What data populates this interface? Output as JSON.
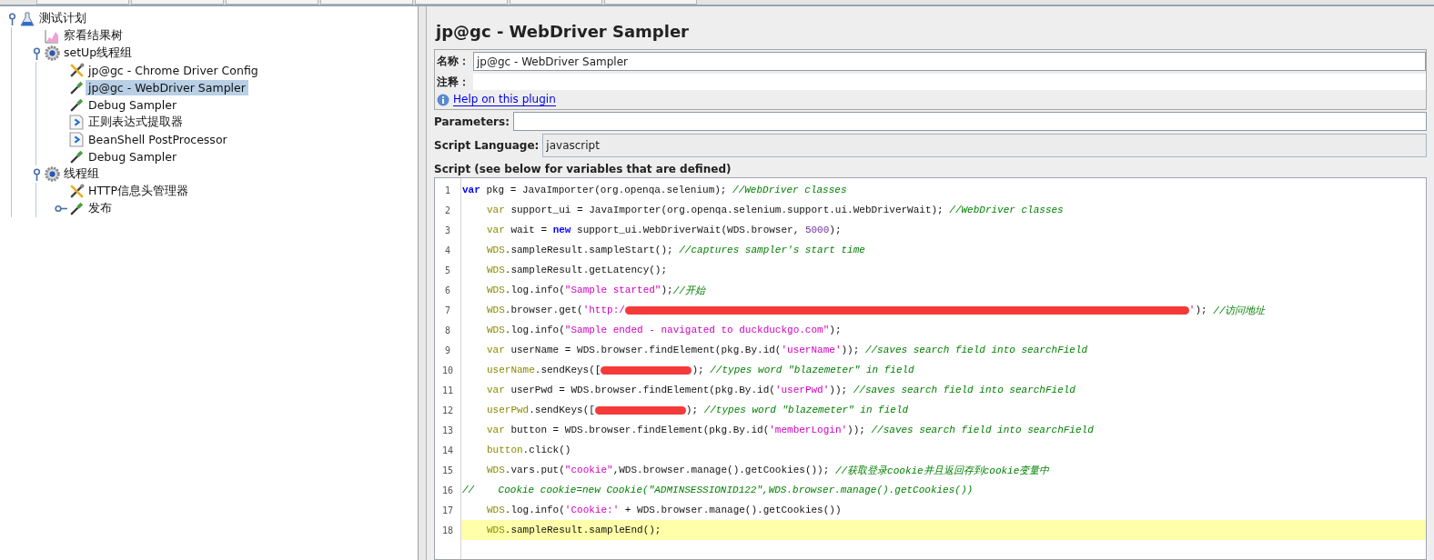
{
  "tree": [
    {
      "label": "测试计划",
      "kind": "plan",
      "selected": false,
      "expanded": true,
      "children": [
        {
          "label": "察看结果树",
          "kind": "listener",
          "selected": false
        },
        {
          "label": "setUp线程组",
          "kind": "threadgroup",
          "selected": false,
          "expanded": true,
          "children": [
            {
              "label": "jp@gc - Chrome Driver Config",
              "kind": "config",
              "selected": false
            },
            {
              "label": "jp@gc - WebDriver Sampler",
              "kind": "sampler",
              "selected": true
            },
            {
              "label": "Debug Sampler",
              "kind": "sampler",
              "selected": false
            },
            {
              "label": "正则表达式提取器",
              "kind": "postprocessor",
              "selected": false
            },
            {
              "label": "BeanShell PostProcessor",
              "kind": "postprocessor",
              "selected": false
            },
            {
              "label": "Debug Sampler",
              "kind": "sampler",
              "selected": false
            }
          ]
        },
        {
          "label": "线程组",
          "kind": "threadgroup",
          "selected": false,
          "expanded": true,
          "children": [
            {
              "label": "HTTP信息头管理器",
              "kind": "config",
              "selected": false
            },
            {
              "label": "发布",
              "kind": "sampler",
              "selected": false,
              "expanded": false
            }
          ]
        }
      ]
    }
  ],
  "panel": {
    "title": "jp@gc - WebDriver Sampler",
    "name_label": "名称：",
    "name_value": "jp@gc - WebDriver Sampler",
    "comment_label": "注释：",
    "help_link": "Help on this plugin",
    "parameters_label": "Parameters:",
    "language_label": "Script Language:",
    "language_value": "javascript",
    "script_label": "Script (see below for variables that are defined)"
  },
  "code": [
    {
      "number": "1",
      "indented": false,
      "highlighted": false,
      "parts": [
        {
          "kind": "keyword",
          "text": "var"
        },
        {
          "kind": "text",
          "text": " pkg = JavaImporter(org.openqa.selenium); "
        },
        {
          "kind": "comment",
          "text": "//WebDriver classes"
        }
      ]
    },
    {
      "number": "2",
      "indented": true,
      "highlighted": false,
      "parts": [
        {
          "kind": "decl",
          "text": "var"
        },
        {
          "kind": "text",
          "text": " support_ui = JavaImporter(org.openqa.selenium.support.ui.WebDriverWait); "
        },
        {
          "kind": "comment",
          "text": "//WebDriver classes"
        }
      ]
    },
    {
      "number": "3",
      "indented": true,
      "highlighted": false,
      "parts": [
        {
          "kind": "decl",
          "text": "var"
        },
        {
          "kind": "text",
          "text": " wait = "
        },
        {
          "kind": "keyword",
          "text": "new"
        },
        {
          "kind": "text",
          "text": " support_ui.WebDriverWait(WDS.browser, "
        },
        {
          "kind": "number",
          "text": "5000"
        },
        {
          "kind": "text",
          "text": ");"
        }
      ]
    },
    {
      "number": "4",
      "indented": true,
      "highlighted": false,
      "parts": [
        {
          "kind": "decl",
          "text": "WDS"
        },
        {
          "kind": "text",
          "text": ".sampleResult.sampleStart(); "
        },
        {
          "kind": "comment",
          "text": "//captures sampler's start time"
        }
      ]
    },
    {
      "number": "5",
      "indented": true,
      "highlighted": false,
      "parts": [
        {
          "kind": "decl",
          "text": "WDS"
        },
        {
          "kind": "text",
          "text": ".sampleResult.getLatency();"
        }
      ]
    },
    {
      "number": "6",
      "indented": true,
      "highlighted": false,
      "parts": [
        {
          "kind": "decl",
          "text": "WDS"
        },
        {
          "kind": "text",
          "text": ".log.info("
        },
        {
          "kind": "string",
          "text": "\"Sample started\""
        },
        {
          "kind": "text",
          "text": ");"
        },
        {
          "kind": "comment",
          "text": "//开始"
        }
      ]
    },
    {
      "number": "7",
      "indented": true,
      "highlighted": false,
      "parts": [
        {
          "kind": "decl",
          "text": "WDS"
        },
        {
          "kind": "text",
          "text": ".browser.get("
        },
        {
          "kind": "string",
          "text": "'http:/"
        },
        {
          "kind": "redacted"
        },
        {
          "kind": "string",
          "text": "'"
        },
        {
          "kind": "text",
          "text": "); "
        },
        {
          "kind": "comment",
          "text": "//访问地址"
        }
      ]
    },
    {
      "number": "8",
      "indented": true,
      "highlighted": false,
      "parts": [
        {
          "kind": "decl",
          "text": "WDS"
        },
        {
          "kind": "text",
          "text": ".log.info("
        },
        {
          "kind": "string",
          "text": "\"Sample ended - navigated to duckduckgo.com\""
        },
        {
          "kind": "text",
          "text": ");"
        }
      ]
    },
    {
      "number": "9",
      "indented": true,
      "highlighted": false,
      "parts": [
        {
          "kind": "decl",
          "text": "var"
        },
        {
          "kind": "text",
          "text": " userName = WDS.browser.findElement(pkg.By.id("
        },
        {
          "kind": "string",
          "text": "'userName'"
        },
        {
          "kind": "text",
          "text": ")); "
        },
        {
          "kind": "comment",
          "text": "//saves search field into searchField"
        }
      ]
    },
    {
      "number": "10",
      "indented": true,
      "highlighted": false,
      "parts": [
        {
          "kind": "decl",
          "text": "userName"
        },
        {
          "kind": "text",
          "text": ".sendKeys(["
        },
        {
          "kind": "redacted"
        },
        {
          "kind": "text",
          "text": "); "
        },
        {
          "kind": "comment",
          "text": "//types word \"blazemeter\" in field"
        }
      ]
    },
    {
      "number": "11",
      "indented": true,
      "highlighted": false,
      "parts": [
        {
          "kind": "decl",
          "text": "var"
        },
        {
          "kind": "text",
          "text": " userPwd = WDS.browser.findElement(pkg.By.id("
        },
        {
          "kind": "string",
          "text": "'userPwd'"
        },
        {
          "kind": "text",
          "text": ")); "
        },
        {
          "kind": "comment",
          "text": "//saves search field into searchField"
        }
      ]
    },
    {
      "number": "12",
      "indented": true,
      "highlighted": false,
      "parts": [
        {
          "kind": "decl",
          "text": "userPwd"
        },
        {
          "kind": "text",
          "text": ".sendKeys(["
        },
        {
          "kind": "redacted"
        },
        {
          "kind": "text",
          "text": "); "
        },
        {
          "kind": "comment",
          "text": "//types word \"blazemeter\" in field"
        }
      ]
    },
    {
      "number": "13",
      "indented": true,
      "highlighted": false,
      "parts": [
        {
          "kind": "decl",
          "text": "var"
        },
        {
          "kind": "text",
          "text": " button = WDS.browser.findElement(pkg.By.id("
        },
        {
          "kind": "string",
          "text": "'memberLogin'"
        },
        {
          "kind": "text",
          "text": ")); "
        },
        {
          "kind": "comment",
          "text": "//saves search field into searchField"
        }
      ]
    },
    {
      "number": "14",
      "indented": true,
      "highlighted": false,
      "parts": [
        {
          "kind": "decl",
          "text": "button"
        },
        {
          "kind": "text",
          "text": ".click()"
        }
      ]
    },
    {
      "number": "15",
      "indented": true,
      "highlighted": false,
      "parts": [
        {
          "kind": "decl",
          "text": "WDS"
        },
        {
          "kind": "text",
          "text": ".vars.put("
        },
        {
          "kind": "string",
          "text": "\"cookie\""
        },
        {
          "kind": "text",
          "text": ",WDS.browser.manage().getCookies()); "
        },
        {
          "kind": "comment",
          "text": "//获取登录cookie并且返回存到cookie变量中"
        }
      ]
    },
    {
      "number": "16",
      "indented": false,
      "highlighted": false,
      "parts": [
        {
          "kind": "comment",
          "text": "//    Cookie cookie=new Cookie(\"ADMINSESSIONID122\",WDS.browser.manage().getCookies())"
        }
      ]
    },
    {
      "number": "17",
      "indented": true,
      "highlighted": false,
      "parts": [
        {
          "kind": "decl",
          "text": "WDS"
        },
        {
          "kind": "text",
          "text": ".log.info("
        },
        {
          "kind": "string",
          "text": "'Cookie:'"
        },
        {
          "kind": "text",
          "text": " + WDS.browser.manage().getCookies())"
        }
      ]
    },
    {
      "number": "18",
      "indented": true,
      "highlighted": true,
      "parts": [
        {
          "kind": "decl",
          "text": "WDS"
        },
        {
          "kind": "text",
          "text": ".sampleResult.sampleEnd();"
        }
      ]
    }
  ]
}
